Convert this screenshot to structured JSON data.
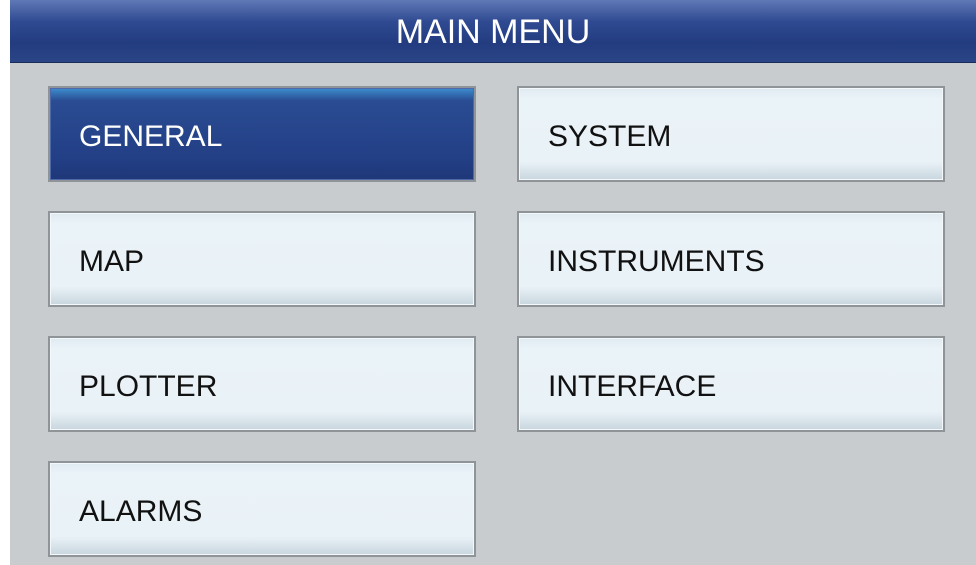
{
  "header": {
    "title": "MAIN MENU"
  },
  "menu": {
    "items": [
      {
        "label": "GENERAL",
        "selected": true
      },
      {
        "label": "SYSTEM",
        "selected": false
      },
      {
        "label": "MAP",
        "selected": false
      },
      {
        "label": "INSTRUMENTS",
        "selected": false
      },
      {
        "label": "PLOTTER",
        "selected": false
      },
      {
        "label": "INTERFACE",
        "selected": false
      },
      {
        "label": "ALARMS",
        "selected": false
      }
    ]
  },
  "colors": {
    "title_bar": "#2f4a91",
    "selected_button": "#233f86",
    "button": "#e9f2f7",
    "background": "#c8cccf"
  }
}
